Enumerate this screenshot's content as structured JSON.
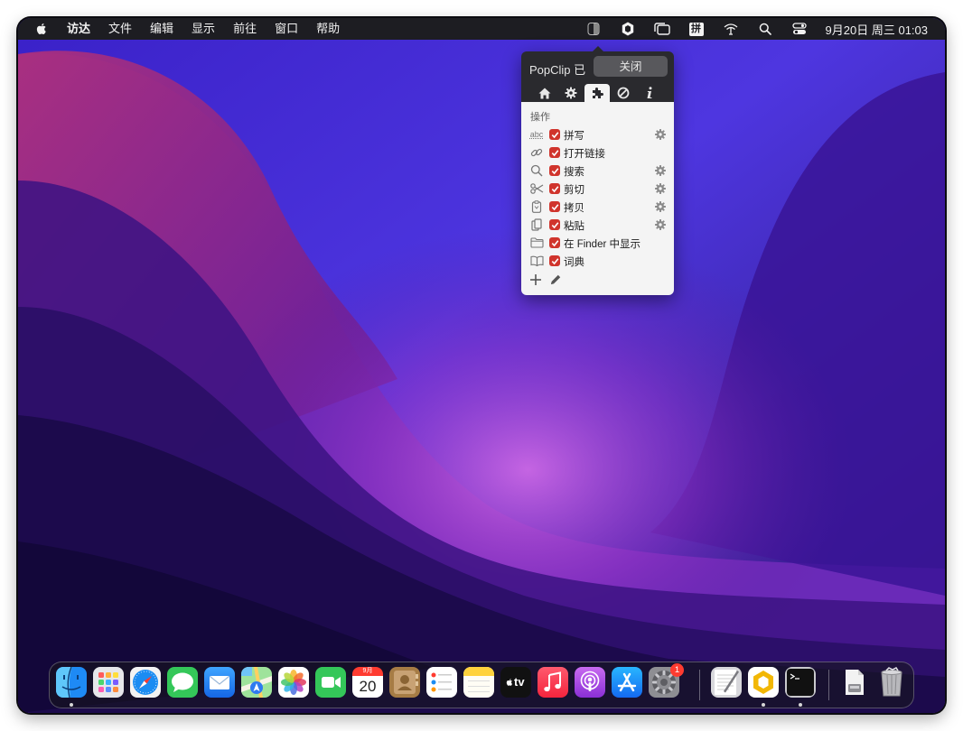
{
  "menubar": {
    "app_name": "访达",
    "menus": [
      "文件",
      "编辑",
      "显示",
      "前往",
      "窗口",
      "帮助"
    ],
    "pinyin_label": "拼",
    "clock": "9月20日 周三  01:03"
  },
  "popclip": {
    "title": "PopClip 已",
    "close_label": "关闭",
    "section_label": "操作",
    "actions": [
      {
        "label": "拼写",
        "enabled": true
      },
      {
        "label": "打开链接",
        "enabled": true
      },
      {
        "label": "搜索",
        "enabled": true
      },
      {
        "label": "剪切",
        "enabled": true
      },
      {
        "label": "拷贝",
        "enabled": true
      },
      {
        "label": "粘贴",
        "enabled": true
      },
      {
        "label": "在 Finder 中显示",
        "enabled": true
      },
      {
        "label": "词典",
        "enabled": true
      }
    ],
    "icon_text": {
      "spell": "abc"
    }
  },
  "dock": {
    "calendar_month": "9月",
    "calendar_day": "20",
    "tv_label": "tv",
    "settings_badge": "1",
    "running_apps": [
      "Finder",
      "PopClip",
      "Terminal"
    ]
  },
  "colors": {
    "menubar_bg": "#1d1d22",
    "checkbox_red": "#d0342c",
    "badge_red": "#ff3b30"
  }
}
